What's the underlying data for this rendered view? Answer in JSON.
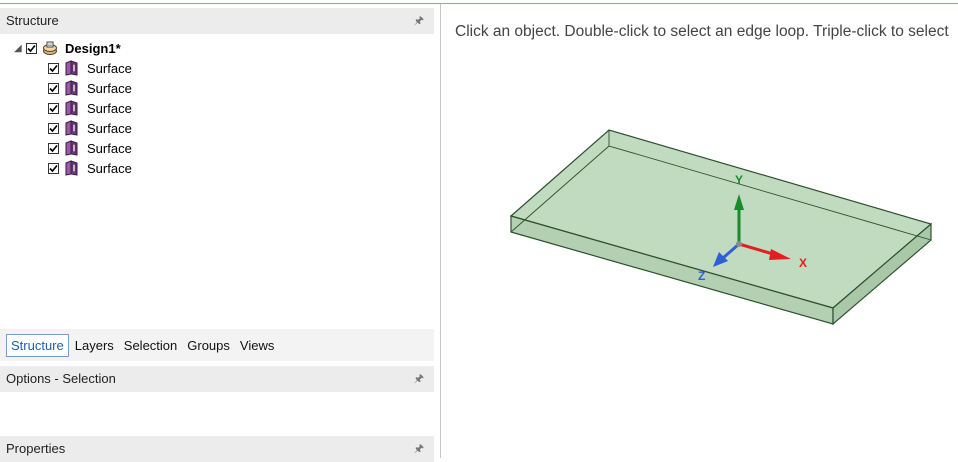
{
  "structure_panel": {
    "title": "Structure",
    "root": {
      "label": "Design1*",
      "checked": true,
      "icon": "design-icon"
    },
    "items": [
      {
        "label": "Surface",
        "checked": true,
        "icon": "surface-icon"
      },
      {
        "label": "Surface",
        "checked": true,
        "icon": "surface-icon"
      },
      {
        "label": "Surface",
        "checked": true,
        "icon": "surface-icon"
      },
      {
        "label": "Surface",
        "checked": true,
        "icon": "surface-icon"
      },
      {
        "label": "Surface",
        "checked": true,
        "icon": "surface-icon"
      },
      {
        "label": "Surface",
        "checked": true,
        "icon": "surface-icon"
      }
    ]
  },
  "tabs": [
    {
      "label": "Structure",
      "active": true
    },
    {
      "label": "Layers",
      "active": false
    },
    {
      "label": "Selection",
      "active": false
    },
    {
      "label": "Groups",
      "active": false
    },
    {
      "label": "Views",
      "active": false
    }
  ],
  "options_panel": {
    "title": "Options - Selection"
  },
  "properties_panel": {
    "title": "Properties"
  },
  "viewport": {
    "hint": "Click an object. Double-click to select an edge loop. Triple-click to select",
    "axes": {
      "x": "X",
      "y": "Y",
      "z": "Z"
    }
  },
  "colors": {
    "plate_fill": "#bfd9bf",
    "plate_edge": "#2f4f2f",
    "axis_x": "#e02020",
    "axis_y": "#1a8a2a",
    "axis_z": "#2f5fd6",
    "accent": "#1f5fa8"
  }
}
